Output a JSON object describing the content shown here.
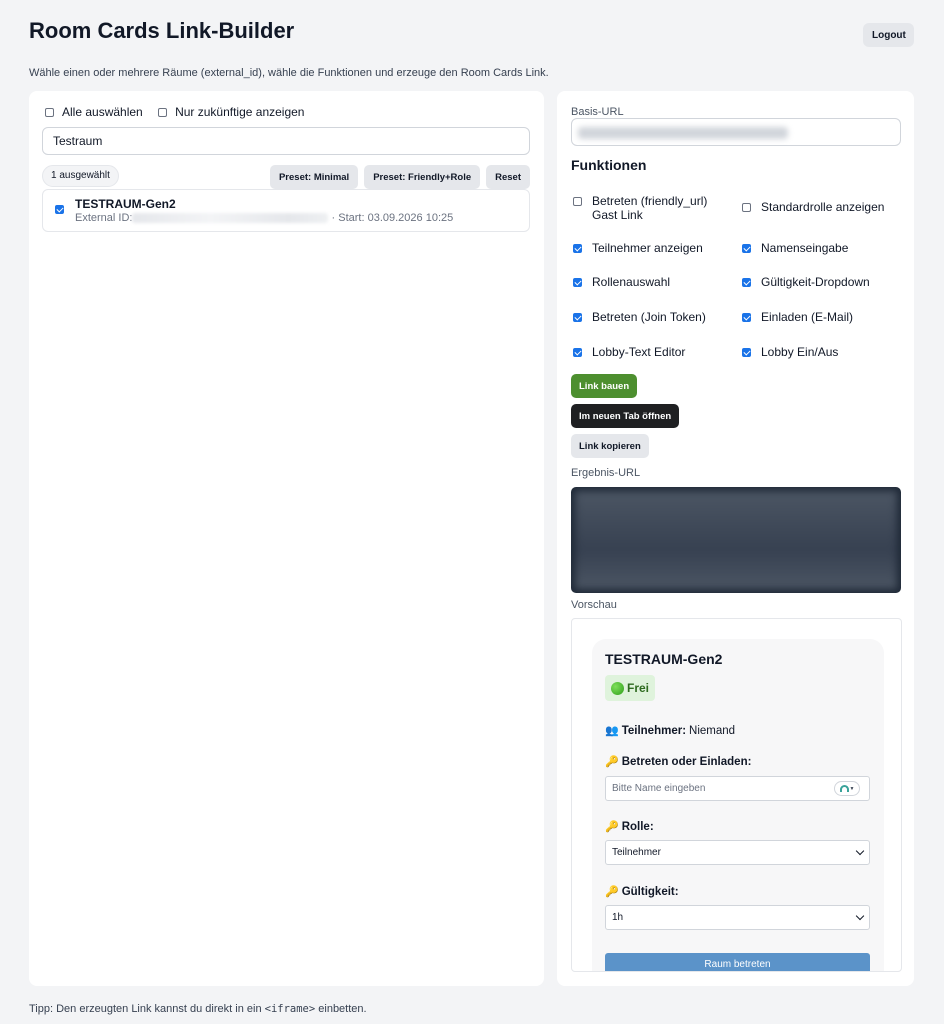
{
  "header": {
    "title": "Room Cards Link-Builder",
    "logout_label": "Logout",
    "subtitle": "Wähle einen oder mehrere Räume (external_id), wähle die Funktionen und erzeuge den Room Cards Link."
  },
  "left": {
    "select_all_label": "Alle auswählen",
    "select_all_checked": false,
    "future_only_label": "Nur zukünftige anzeigen",
    "future_only_checked": false,
    "search_value": "Testraum",
    "selected_count": "1 ausgewählt",
    "preset_minimal": "Preset: Minimal",
    "preset_friendly_role": "Preset: Friendly+Role",
    "reset_label": "Reset",
    "rooms": [
      {
        "name": "TESTRAUM-Gen2",
        "checked": true,
        "external_id_label": "External ID:",
        "start": "· Start: 03.09.2026 10:25"
      }
    ]
  },
  "right": {
    "basis_url_label": "Basis-URL",
    "functions_heading": "Funktionen",
    "functions": [
      {
        "label": "Betreten (friendly_url) Gast Link",
        "checked": false
      },
      {
        "label": "Standardrolle anzeigen",
        "checked": false
      },
      {
        "label": "Teilnehmer anzeigen",
        "checked": true
      },
      {
        "label": "Namenseingabe",
        "checked": true
      },
      {
        "label": "Rollenauswahl",
        "checked": true
      },
      {
        "label": "Gültigkeit-Dropdown",
        "checked": true
      },
      {
        "label": "Betreten (Join Token)",
        "checked": true
      },
      {
        "label": "Einladen (E-Mail)",
        "checked": true
      },
      {
        "label": "Lobby-Text Editor",
        "checked": true
      },
      {
        "label": "Lobby Ein/Aus",
        "checked": true
      }
    ],
    "build_label": "Link bauen",
    "open_tab_label": "Im neuen Tab öffnen",
    "copy_label": "Link kopieren",
    "result_label": "Ergebnis-URL",
    "preview_label": "Vorschau"
  },
  "preview": {
    "room_title": "TESTRAUM-Gen2",
    "status": "Frei",
    "participants_label": "Teilnehmer:",
    "participants_value": "Niemand",
    "join_invite_label": "Betreten oder Einladen:",
    "name_placeholder": "Bitte Name eingeben",
    "role_label": "Rolle:",
    "role_value": "Teilnehmer",
    "validity_label": "Gültigkeit:",
    "validity_value": "1h",
    "join_button": "Raum betreten"
  },
  "footer": {
    "tip_prefix": "Tipp: Den erzeugten Link kannst du direkt in ein ",
    "tip_code": "<iframe>",
    "tip_suffix": " einbetten."
  },
  "colors": {
    "accent_green": "#4d8f2f",
    "dark_button": "#1f2022",
    "checkbox_blue": "#1a73e8",
    "join_blue": "#5b93c9"
  }
}
